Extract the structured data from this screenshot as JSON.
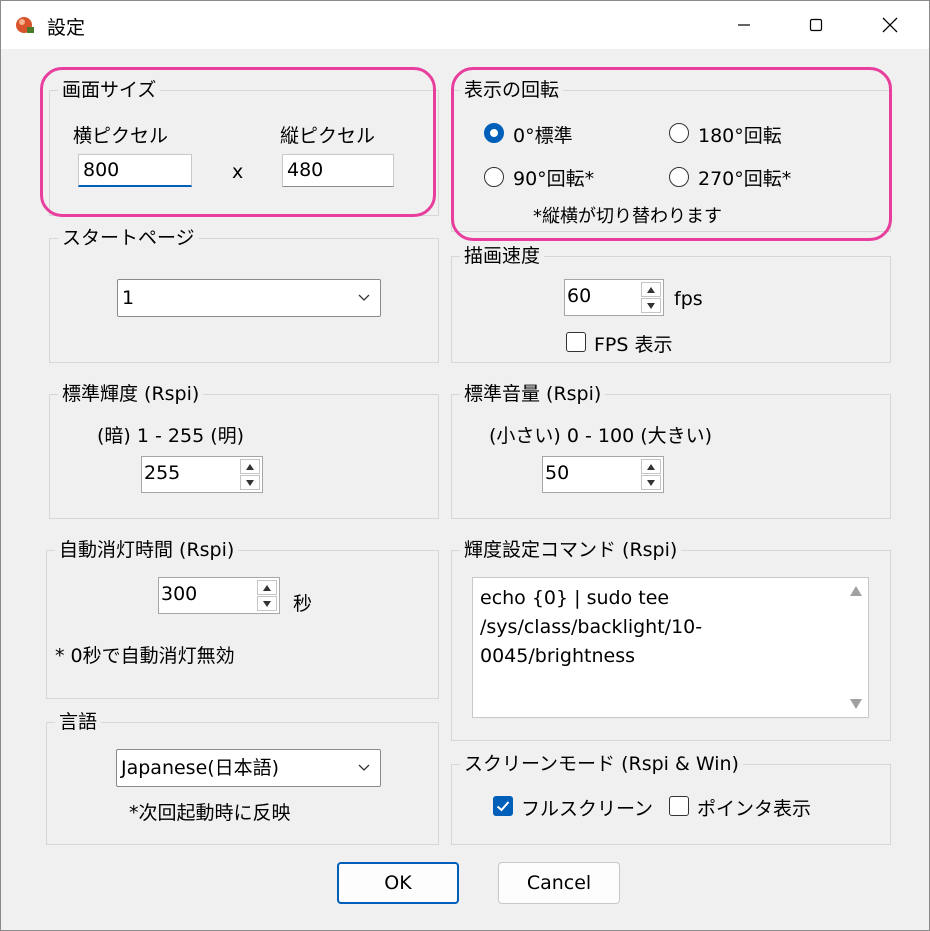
{
  "window": {
    "title": "設定"
  },
  "screen_size": {
    "legend": "画面サイズ",
    "width_label": "横ピクセル",
    "height_label": "縦ピクセル",
    "width_value": "800",
    "height_value": "480",
    "separator": "x"
  },
  "rotation": {
    "legend": "表示の回転",
    "options": [
      "0°標準",
      "180°回転",
      "90°回転*",
      "270°回転*"
    ],
    "selected": "0°標準",
    "note": "*縦横が切り替わります"
  },
  "start_page": {
    "legend": "スタートページ",
    "value": "1"
  },
  "draw_speed": {
    "legend": "描画速度",
    "value": "60",
    "unit": "fps",
    "fps_checkbox_label": "FPS 表示",
    "fps_checked": false
  },
  "brightness": {
    "legend": "標準輝度 (Rspi)",
    "range_label": "(暗) 1 - 255 (明)",
    "value": "255"
  },
  "volume": {
    "legend": "標準音量 (Rspi)",
    "range_label": "(小さい) 0 - 100 (大きい)",
    "value": "50"
  },
  "auto_off": {
    "legend": "自動消灯時間 (Rspi)",
    "value": "300",
    "unit": "秒",
    "note": "* 0秒で自動消灯無効"
  },
  "brightness_command": {
    "legend": "輝度設定コマンド (Rspi)",
    "value": "echo {0} | sudo tee\n/sys/class/backlight/10-\n0045/brightness"
  },
  "language": {
    "legend": "言語",
    "value": "Japanese(日本語)",
    "note": "*次回起動時に反映"
  },
  "screen_mode": {
    "legend": "スクリーンモード  (Rspi & Win)",
    "fullscreen_label": "フルスクリーン",
    "fullscreen_checked": true,
    "pointer_label": "ポインタ表示",
    "pointer_checked": false
  },
  "buttons": {
    "ok": "OK",
    "cancel": "Cancel"
  },
  "colors": {
    "accent": "#005fb8",
    "highlight": "#e83e9e"
  }
}
